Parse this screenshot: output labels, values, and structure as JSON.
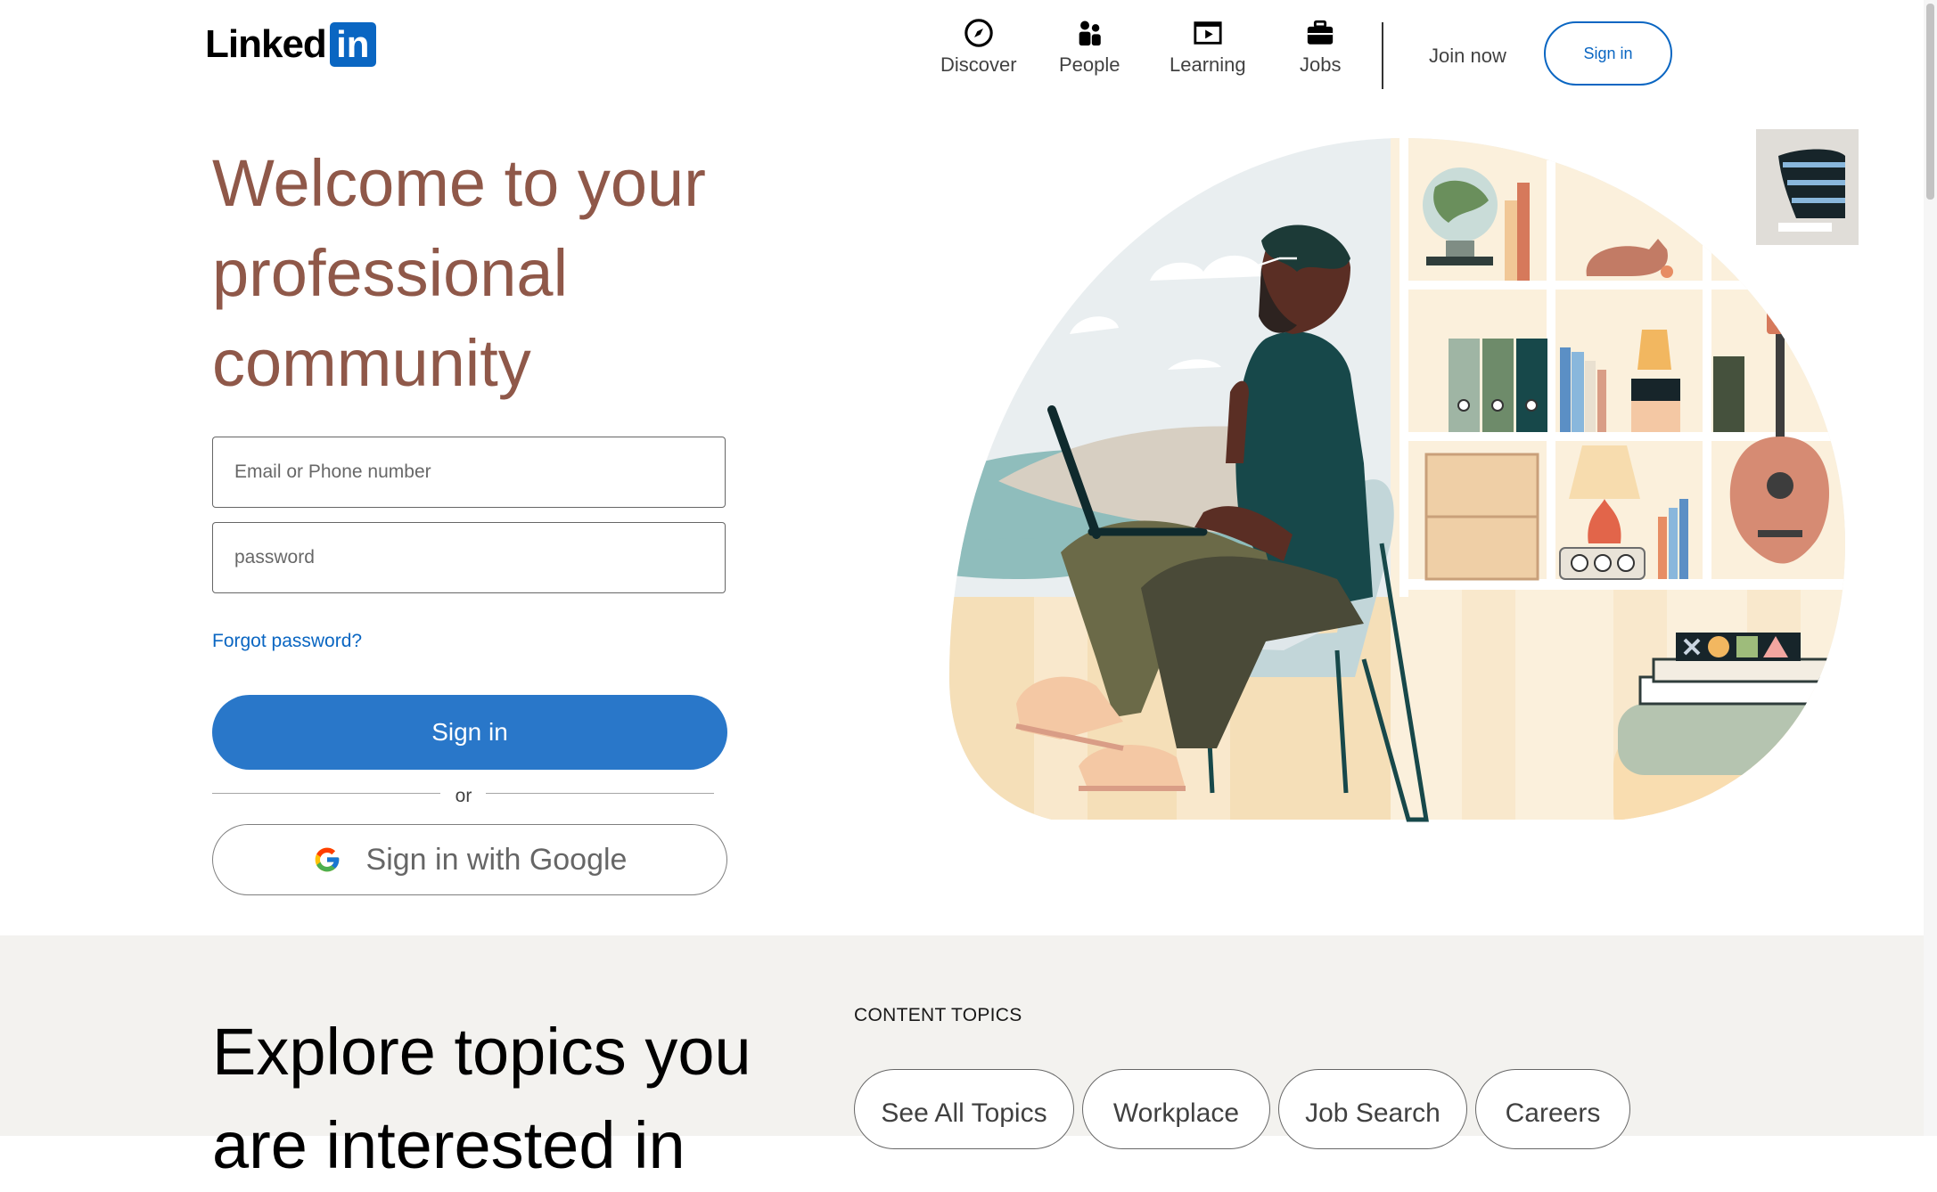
{
  "brand": {
    "logo_text": "Linked",
    "logo_box": "in",
    "accent": "#0a66c2"
  },
  "nav": {
    "items": [
      {
        "label": "Discover",
        "icon": "compass-icon"
      },
      {
        "label": "People",
        "icon": "people-icon"
      },
      {
        "label": "Learning",
        "icon": "video-play-icon"
      },
      {
        "label": "Jobs",
        "icon": "briefcase-icon"
      }
    ],
    "join_now": "Join now",
    "sign_in": "Sign in"
  },
  "hero": {
    "title_lines": [
      "Welcome to your",
      "professional",
      "community"
    ],
    "title_color": "#8f5849"
  },
  "form": {
    "email_placeholder": "Email or Phone number",
    "password_placeholder": "password",
    "forgot_password": "Forgot password?",
    "sign_in_button": "Sign in",
    "or_text": "or",
    "google_button": "Sign in with Google",
    "button_color": "#2977c9"
  },
  "explore": {
    "title": "Explore topics you",
    "title_line2": "are interested in",
    "topics_heading": "CONTENT TOPICS",
    "topics": [
      "See All Topics",
      "Workplace",
      "Job Search",
      "Careers"
    ]
  }
}
